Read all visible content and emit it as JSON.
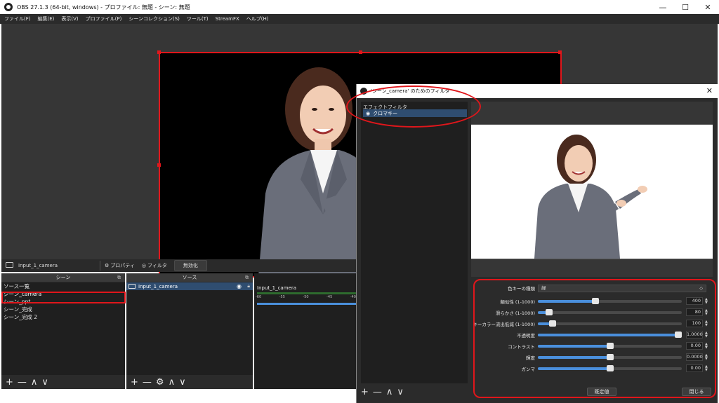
{
  "window": {
    "title": "OBS 27.1.3 (64-bit, windows) - プロファイル: 無題 - シーン: 無題",
    "minimize": "—",
    "maximize": "☐",
    "close": "✕"
  },
  "menubar": {
    "items": [
      "ファイル(F)",
      "編集(E)",
      "表示(V)",
      "プロファイル(P)",
      "シーンコレクション(S)",
      "ツール(T)",
      "StreamFX",
      "ヘルプ(H)"
    ]
  },
  "source_strip": {
    "source_name": "Input_1_camera",
    "properties": "プロパティ",
    "filters": "フィルタ",
    "disable": "無効化"
  },
  "scenes": {
    "header": "シーン",
    "items": [
      "ソース一覧",
      "シーン_camera",
      "シーン_ppt",
      "シーン_完成",
      "シーン_完成 2"
    ],
    "selected": "シーン_camera"
  },
  "sources": {
    "header": "ソース",
    "items": [
      "Input_1_camera"
    ]
  },
  "mixer": {
    "track_name": "Input_1_camera",
    "ticks": [
      "-60",
      "-55",
      "-50",
      "-45",
      "-40"
    ]
  },
  "dock_controls": {
    "add": "+",
    "remove": "—",
    "up": "∧",
    "down": "∨"
  },
  "dialog": {
    "title": "'シーン_camera' のためのフィルタ",
    "close": "✕",
    "effect_filters_label": "エフェクトフィルタ",
    "filters": [
      "クロマキー"
    ],
    "properties": {
      "key_color_type": {
        "label": "色キーの種類",
        "value": "緑"
      },
      "sliders": [
        {
          "label": "類似性 (1-1000)",
          "value": "400",
          "level": 0.4
        },
        {
          "label": "滑らかさ (1-1000)",
          "value": "80",
          "level": 0.08
        },
        {
          "label": "キーカラー流出低減 (1-1000)",
          "value": "100",
          "level": 0.1
        },
        {
          "label": "不透明度",
          "value": "1.0000",
          "level": 1.0
        },
        {
          "label": "コントラスト",
          "value": "0.00",
          "level": 0.5
        },
        {
          "label": "輝度",
          "value": "0.0000",
          "level": 0.5
        },
        {
          "label": "ガンマ",
          "value": "0.00",
          "level": 0.5
        }
      ]
    },
    "defaults_button": "既定値",
    "close_button": "閉じる"
  }
}
